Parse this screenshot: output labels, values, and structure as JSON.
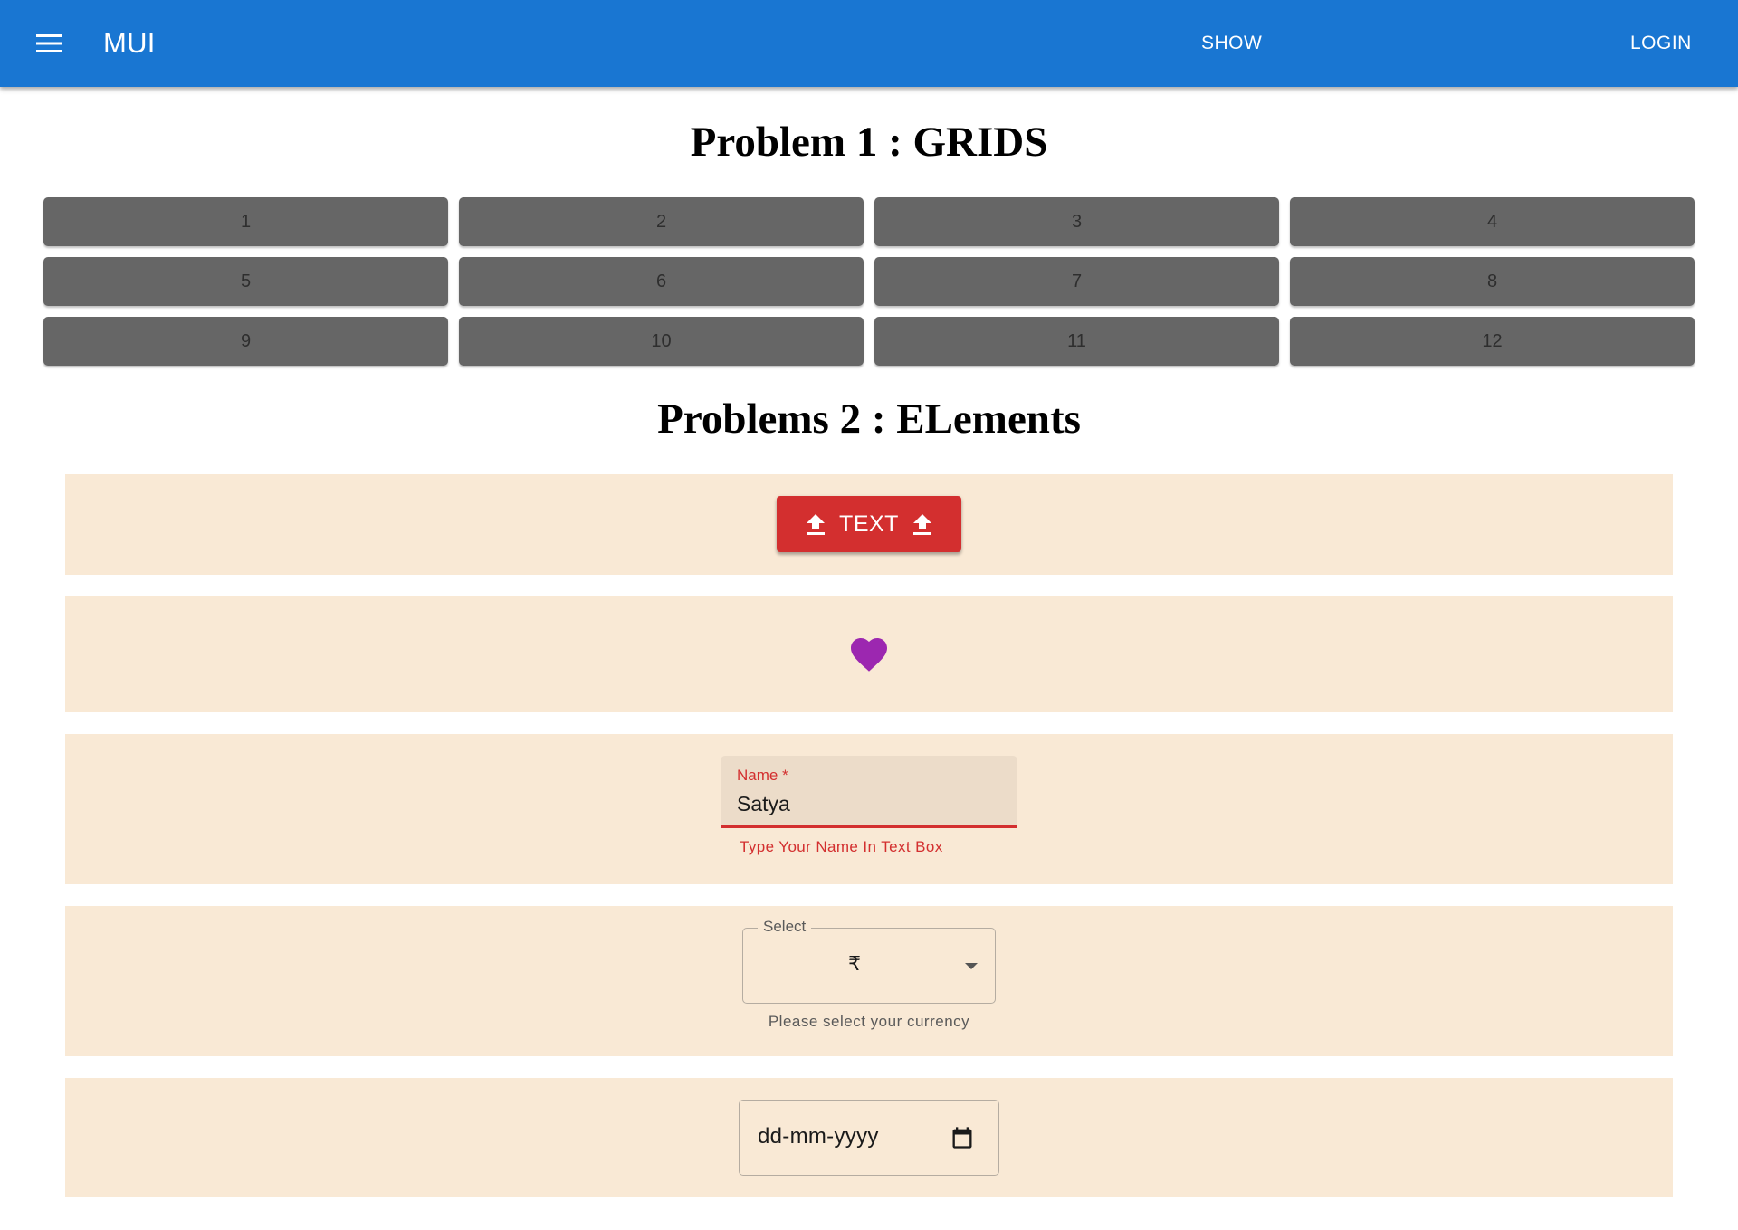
{
  "appbar": {
    "brand": "MUI",
    "menu_icon": "hamburger-menu-icon",
    "nav": [
      {
        "label": "SHOW"
      },
      {
        "label": "LOGIN"
      }
    ],
    "color": "#1976d2"
  },
  "problem1": {
    "title": "Problem 1 : GRIDS",
    "cells": [
      "1",
      "2",
      "3",
      "4",
      "5",
      "6",
      "7",
      "8",
      "9",
      "10",
      "11",
      "12"
    ],
    "cell_color": "#666666"
  },
  "problem2": {
    "title": "Problems 2 : ELements",
    "panel_color": "#f9e9d5",
    "text_button": {
      "label": "TEXT",
      "icon": "upload-icon",
      "color": "#d32f2f"
    },
    "heart": {
      "icon": "heart-icon",
      "color": "#9c27b0"
    },
    "name_field": {
      "label": "Name",
      "required_mark": "*",
      "value": "Satya",
      "helper": "Type Your Name In Text Box",
      "error_color": "#d32f2f"
    },
    "currency_select": {
      "label": "Select",
      "value": "₹",
      "helper": "Please select your currency"
    },
    "date_field": {
      "placeholder": "dd-mm-yyyy",
      "icon": "calendar-icon"
    }
  }
}
